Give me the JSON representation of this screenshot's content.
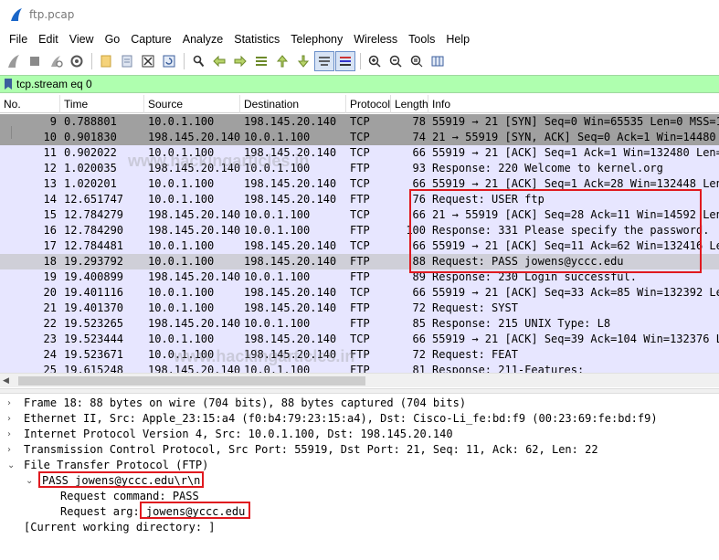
{
  "window": {
    "title": "ftp.pcap"
  },
  "menu": [
    "File",
    "Edit",
    "View",
    "Go",
    "Capture",
    "Analyze",
    "Statistics",
    "Telephony",
    "Wireless",
    "Tools",
    "Help"
  ],
  "toolbar_icons": [
    "shark-fin-start-icon",
    "stop-icon",
    "restart-icon",
    "options-gear-icon",
    "open-file-icon",
    "save-file-icon",
    "close-file-icon",
    "reload-icon",
    "find-icon",
    "back-arrow-icon",
    "forward-arrow-icon",
    "go-to-packet-icon",
    "first-packet-icon",
    "last-packet-icon",
    "autoscroll-icon",
    "colorize-icon",
    "zoom-in-icon",
    "zoom-out-icon",
    "zoom-reset-icon",
    "resize-columns-icon"
  ],
  "filter": {
    "value": "tcp.stream eq 0"
  },
  "columns": {
    "no": "No.",
    "time": "Time",
    "source": "Source",
    "destination": "Destination",
    "protocol": "Protocol",
    "length": "Length",
    "info": "Info"
  },
  "packets": [
    {
      "no": "9",
      "time": "0.788801",
      "source": "10.0.1.100",
      "destination": "198.145.20.140",
      "protocol": "TCP",
      "length": "78",
      "info": "55919 → 21 [SYN] Seq=0 Win=65535 Len=0 MSS=14",
      "style": "tcpdark"
    },
    {
      "no": "10",
      "time": "0.901830",
      "source": "198.145.20.140",
      "destination": "10.0.1.100",
      "protocol": "TCP",
      "length": "74",
      "info": "21 → 55919 [SYN, ACK] Seq=0 Ack=1 Win=14480 L",
      "style": "tcpdark"
    },
    {
      "no": "11",
      "time": "0.902022",
      "source": "10.0.1.100",
      "destination": "198.145.20.140",
      "protocol": "TCP",
      "length": "66",
      "info": "55919 → 21 [ACK] Seq=1 Ack=1 Win=132480 Len=0",
      "style": "tcp"
    },
    {
      "no": "12",
      "time": "1.020035",
      "source": "198.145.20.140",
      "destination": "10.0.1.100",
      "protocol": "FTP",
      "length": "93",
      "info": "Response: 220 Welcome to kernel.org",
      "style": "tcp"
    },
    {
      "no": "13",
      "time": "1.020201",
      "source": "10.0.1.100",
      "destination": "198.145.20.140",
      "protocol": "TCP",
      "length": "66",
      "info": "55919 → 21 [ACK] Seq=1 Ack=28 Win=132448 Len=",
      "style": "tcp"
    },
    {
      "no": "14",
      "time": "12.651747",
      "source": "10.0.1.100",
      "destination": "198.145.20.140",
      "protocol": "FTP",
      "length": "76",
      "info": "Request: USER ftp",
      "style": "tcp"
    },
    {
      "no": "15",
      "time": "12.784279",
      "source": "198.145.20.140",
      "destination": "10.0.1.100",
      "protocol": "TCP",
      "length": "66",
      "info": "21 → 55919 [ACK] Seq=28 Ack=11 Win=14592 Len=",
      "style": "tcp"
    },
    {
      "no": "16",
      "time": "12.784290",
      "source": "198.145.20.140",
      "destination": "10.0.1.100",
      "protocol": "FTP",
      "length": "100",
      "info": "Response: 331 Please specify the password.",
      "style": "tcp"
    },
    {
      "no": "17",
      "time": "12.784481",
      "source": "10.0.1.100",
      "destination": "198.145.20.140",
      "protocol": "TCP",
      "length": "66",
      "info": "55919 → 21 [ACK] Seq=11 Ack=62 Win=132416 Len",
      "style": "tcp"
    },
    {
      "no": "18",
      "time": "19.293792",
      "source": "10.0.1.100",
      "destination": "198.145.20.140",
      "protocol": "FTP",
      "length": "88",
      "info": "Request: PASS jowens@yccc.edu",
      "style": "sel"
    },
    {
      "no": "19",
      "time": "19.400899",
      "source": "198.145.20.140",
      "destination": "10.0.1.100",
      "protocol": "FTP",
      "length": "89",
      "info": "Response: 230 Login successful.",
      "style": "tcp"
    },
    {
      "no": "20",
      "time": "19.401116",
      "source": "10.0.1.100",
      "destination": "198.145.20.140",
      "protocol": "TCP",
      "length": "66",
      "info": "55919 → 21 [ACK] Seq=33 Ack=85 Win=132392 Len",
      "style": "tcp"
    },
    {
      "no": "21",
      "time": "19.401370",
      "source": "10.0.1.100",
      "destination": "198.145.20.140",
      "protocol": "FTP",
      "length": "72",
      "info": "Request: SYST",
      "style": "tcp"
    },
    {
      "no": "22",
      "time": "19.523265",
      "source": "198.145.20.140",
      "destination": "10.0.1.100",
      "protocol": "FTP",
      "length": "85",
      "info": "Response: 215 UNIX Type: L8",
      "style": "tcp"
    },
    {
      "no": "23",
      "time": "19.523444",
      "source": "10.0.1.100",
      "destination": "198.145.20.140",
      "protocol": "TCP",
      "length": "66",
      "info": "55919 → 21 [ACK] Seq=39 Ack=104 Win=132376 Le",
      "style": "tcp"
    },
    {
      "no": "24",
      "time": "19.523671",
      "source": "10.0.1.100",
      "destination": "198.145.20.140",
      "protocol": "FTP",
      "length": "72",
      "info": "Request: FEAT",
      "style": "tcp"
    },
    {
      "no": "25",
      "time": "19.615248",
      "source": "198.145.20.140",
      "destination": "10.0.1.100",
      "protocol": "FTP",
      "length": "81",
      "info": "Response: 211-Features:",
      "style": "tcp"
    }
  ],
  "details": [
    {
      "text": "Frame 18: 88 bytes on wire (704 bits), 88 bytes captured (704 bits)",
      "toggle": ">",
      "indent": 0
    },
    {
      "text": "Ethernet II, Src: Apple_23:15:a4 (f0:b4:79:23:15:a4), Dst: Cisco-Li_fe:bd:f9 (00:23:69:fe:bd:f9)",
      "toggle": ">",
      "indent": 0
    },
    {
      "text": "Internet Protocol Version 4, Src: 10.0.1.100, Dst: 198.145.20.140",
      "toggle": ">",
      "indent": 0
    },
    {
      "text": "Transmission Control Protocol, Src Port: 55919, Dst Port: 21, Seq: 11, Ack: 62, Len: 22",
      "toggle": ">",
      "indent": 0
    },
    {
      "text": "File Transfer Protocol (FTP)",
      "toggle": "v",
      "indent": 0
    },
    {
      "text": "PASS jowens@yccc.edu\\r\\n",
      "toggle": "v",
      "indent": 1
    },
    {
      "text": "Request command: PASS",
      "toggle": "",
      "indent": 2
    },
    {
      "text": "Request arg: jowens@yccc.edu",
      "toggle": "",
      "indent": 2
    },
    {
      "text": "[Current working directory: ]",
      "toggle": "",
      "indent": 0
    }
  ],
  "colors": {
    "filter_bg": "#afffaf",
    "tcp_row": "#e7e6ff",
    "selected_row": "#cfcfd8",
    "syn_row": "#a0a0a0",
    "highlight_box": "#e0191f"
  }
}
